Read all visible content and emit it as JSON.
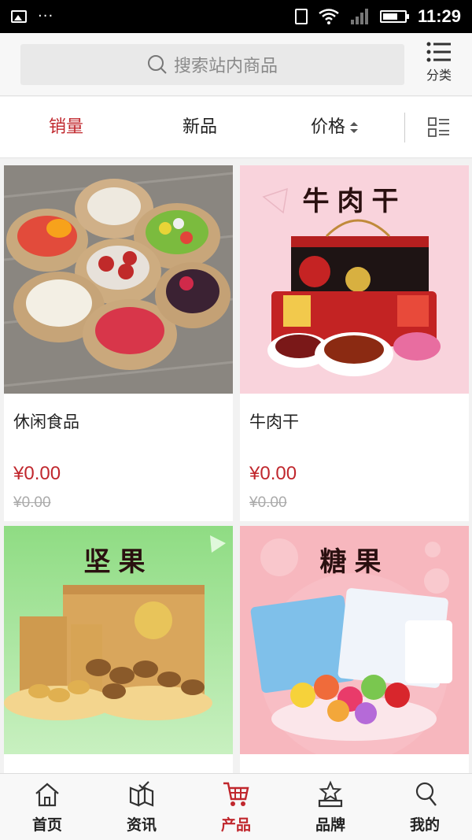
{
  "status_bar": {
    "time": "11:29",
    "dots": "···"
  },
  "search": {
    "placeholder": "搜索站内商品"
  },
  "category_button": {
    "label": "分类"
  },
  "sort": {
    "sales": "销量",
    "new": "新品",
    "price": "价格"
  },
  "products": [
    {
      "name": "休闲食品",
      "price": "¥0.00",
      "old_price": "¥0.00",
      "banner": ""
    },
    {
      "name": "牛肉干",
      "price": "¥0.00",
      "old_price": "¥0.00",
      "banner": "牛肉干"
    },
    {
      "name": "",
      "price": "",
      "old_price": "",
      "banner": "坚果"
    },
    {
      "name": "",
      "price": "",
      "old_price": "",
      "banner": "糖果"
    }
  ],
  "tabs": [
    {
      "label": "首页",
      "icon": "home-icon"
    },
    {
      "label": "资讯",
      "icon": "news-icon"
    },
    {
      "label": "产品",
      "icon": "cart-icon"
    },
    {
      "label": "品牌",
      "icon": "brand-icon"
    },
    {
      "label": "我的",
      "icon": "user-icon"
    }
  ],
  "colors": {
    "accent": "#c0272d",
    "pink_bg": "#f9d3dc",
    "green_bg": "#a9e8a0"
  }
}
